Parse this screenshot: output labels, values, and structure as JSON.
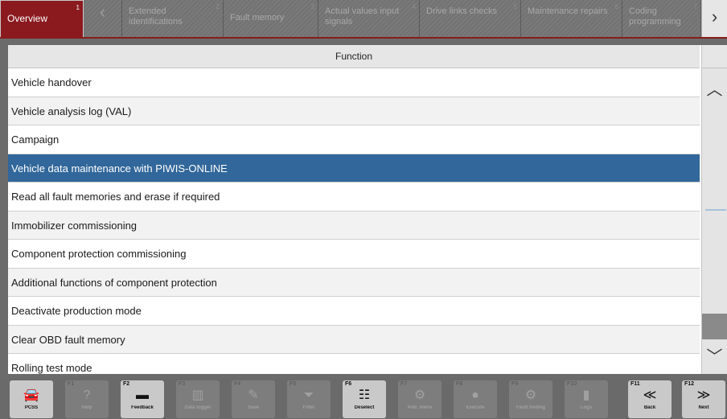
{
  "tabs": [
    {
      "label": "Overview",
      "number": "1",
      "active": true
    },
    {
      "label": "Extended identifications",
      "number": "2"
    },
    {
      "label": "Fault memory",
      "number": "3"
    },
    {
      "label": "Actual values input signals",
      "number": "4"
    },
    {
      "label": "Drive links checks",
      "number": "5"
    },
    {
      "label": "Maintenance repairs",
      "number": "6"
    },
    {
      "label": "Coding programming",
      "number": "7"
    }
  ],
  "table": {
    "header": "Function",
    "rows": [
      "Vehicle handover",
      "Vehicle analysis log (VAL)",
      "Campaign",
      "Vehicle data maintenance with PIWIS-ONLINE",
      "Read all fault memories and erase if required",
      "Immobilizer commissioning",
      "Component protection commissioning",
      "Additional functions of component protection",
      "Deactivate production mode",
      "Clear OBD fault memory",
      "Rolling test mode"
    ],
    "selected_index": 3
  },
  "fkeys": [
    {
      "num": "",
      "icon": "car-icon",
      "glyph": "🚘",
      "label": "PCSS",
      "enabled": true
    },
    {
      "num": "F1",
      "icon": "help-icon",
      "glyph": "?",
      "label": "Help",
      "enabled": false
    },
    {
      "num": "F2",
      "icon": "feedback-icon",
      "glyph": "▬",
      "label": "Feedback",
      "enabled": true
    },
    {
      "num": "F3",
      "icon": "chart-icon",
      "glyph": "▥",
      "label": "Data logger",
      "enabled": false
    },
    {
      "num": "F4",
      "icon": "edit-icon",
      "glyph": "✎",
      "label": "Save",
      "enabled": false
    },
    {
      "num": "F5",
      "icon": "filter-icon",
      "glyph": "⏷",
      "label": "Filter",
      "enabled": false
    },
    {
      "num": "F6",
      "icon": "deselect-icon",
      "glyph": "☷",
      "label": "Deselect",
      "enabled": true
    },
    {
      "num": "F7",
      "icon": "tools-icon",
      "glyph": "⚙",
      "label": "Add. menu",
      "enabled": false
    },
    {
      "num": "F8",
      "icon": "execute-icon",
      "glyph": "●",
      "label": "Execute",
      "enabled": false
    },
    {
      "num": "F9",
      "icon": "faultfind-icon",
      "glyph": "⚙",
      "label": "Fault finding",
      "enabled": false
    },
    {
      "num": "F10",
      "icon": "logs-icon",
      "glyph": "▮",
      "label": "Logs",
      "enabled": false
    },
    {
      "num": "F11",
      "icon": "back-icon",
      "glyph": "≪",
      "label": "Back",
      "enabled": true
    },
    {
      "num": "F12",
      "icon": "next-icon",
      "glyph": "≫",
      "label": "Next",
      "enabled": true
    }
  ],
  "icons": {
    "prev": "‹",
    "next": "›",
    "scroll_up": "︿",
    "scroll_down": "﹀"
  },
  "colors": {
    "active_tab": "#8b1a1f",
    "selection": "#31679a"
  }
}
